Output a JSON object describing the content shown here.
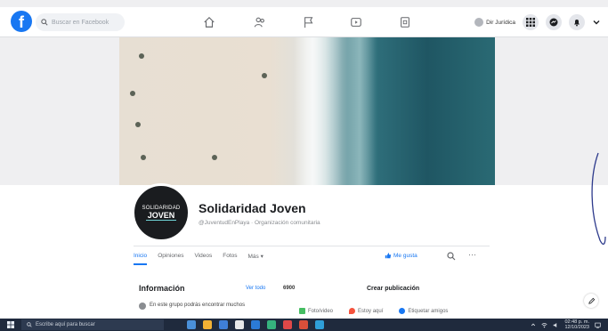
{
  "topbar": {
    "search_placeholder": "Buscar en Facebook",
    "account_name": "Dir Jurídica"
  },
  "icons": [
    "facebook-logo-icon",
    "search-icon",
    "home-icon",
    "friends-icon",
    "flag-icon",
    "video-icon",
    "marketplace-icon",
    "menu-grid-icon",
    "messenger-icon",
    "bell-icon",
    "chevron-down-icon"
  ],
  "page": {
    "avatar_line1": "SOLIDARIDAD",
    "avatar_line2": "JOVEN",
    "name": "Solidaridad Joven",
    "handle": "@JuventudEnPlaya · Organización comunitaria"
  },
  "tabs": [
    {
      "label": "Inicio",
      "active": true
    },
    {
      "label": "Opiniones",
      "active": false
    },
    {
      "label": "Videos",
      "active": false
    },
    {
      "label": "Fotos",
      "active": false
    },
    {
      "label": "Más ▾",
      "active": false
    }
  ],
  "actions": {
    "like": "Me gusta",
    "more": "···"
  },
  "info": {
    "title": "Información",
    "edit": "Ver todo",
    "count": "6900",
    "description": "En este grupo podrás encontrar muchos"
  },
  "create_post": {
    "title": "Crear publicación",
    "options": [
      {
        "label": "Foto/video",
        "color": "#45bd62"
      },
      {
        "label": "Estoy aquí",
        "color": "#f5533d"
      },
      {
        "label": "Etiquetar amigos",
        "color": "#1877f2"
      }
    ]
  },
  "taskbar": {
    "search_placeholder": "Escribe aquí para buscar",
    "time": "02:48 p. m.",
    "date": "12/10/2023",
    "apps": [
      "#4a90d9",
      "#f2b134",
      "#3f7fd8",
      "#e8e8e8",
      "#2b7bd6",
      "#36b37e",
      "#e04848",
      "#d94f3a",
      "#2f9fd8"
    ]
  },
  "colors": {
    "brand": "#1877f2",
    "taskbar": "#1f2a3d"
  }
}
